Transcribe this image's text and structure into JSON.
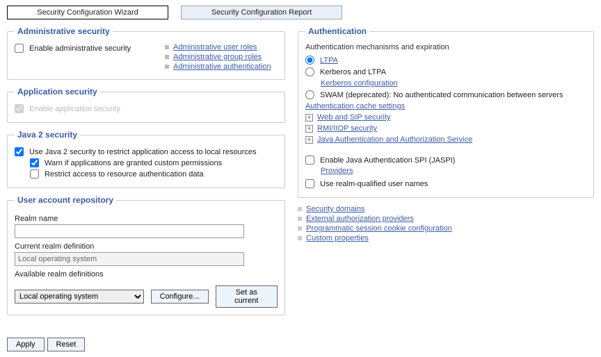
{
  "tabs": {
    "wizard": "Security Configuration Wizard",
    "report": "Security Configuration Report"
  },
  "admin_sec": {
    "legend": "Administrative security",
    "enable_label": "Enable administrative security",
    "links": {
      "roles_user": "Administrative user roles",
      "roles_group": "Administrative group roles",
      "auth": "Administrative authentication"
    }
  },
  "app_sec": {
    "legend": "Application security",
    "enable_label": "Enable application security"
  },
  "java2_sec": {
    "legend": "Java 2 security",
    "use_label": "Use Java 2 security to restrict application access to local resources",
    "warn_label": "Warn if applications are granted custom permissions",
    "restrict_label": "Restrict access to resource authentication data"
  },
  "repo": {
    "legend": "User account repository",
    "realm_name_label": "Realm name",
    "realm_name_value": "",
    "current_realm_label": "Current realm definition",
    "current_realm_value": "Local operating system",
    "available_label": "Available realm definitions",
    "available_selected": "Local operating system",
    "configure_btn": "Configure...",
    "set_current_btn": "Set as current"
  },
  "auth": {
    "legend": "Authentication",
    "subtext": "Authentication mechanisms and expiration",
    "ltpa": "LTPA",
    "kerb": "Kerberos and LTPA",
    "kerb_cfg": "Kerberos configuration",
    "swam": "SWAM (deprecated): No authenticated communication between servers",
    "cache_link": "Authentication cache settings",
    "exp_web": "Web and SIP security",
    "exp_rmi": "RMI/IIOP security",
    "exp_jaas": "Java Authentication and Authorization Service",
    "jaspi_enable": "Enable Java Authentication SPI (JASPI)",
    "jaspi_providers": "Providers",
    "realm_qual": "Use realm-qualified user names",
    "bottom_links": {
      "domains": "Security domains",
      "ext_auth": "External authorization providers",
      "prog_cookie": "Programmatic session cookie configuration",
      "custom_props": "Custom properties"
    }
  },
  "footer": {
    "apply": "Apply",
    "reset": "Reset"
  }
}
